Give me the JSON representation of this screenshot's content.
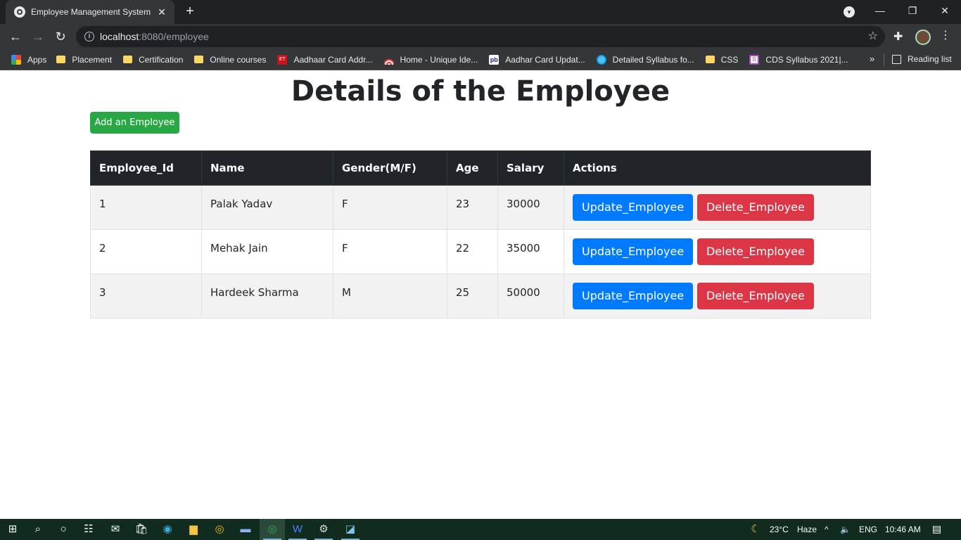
{
  "browser": {
    "tab_title": "Employee Management System",
    "tab_close": "✕",
    "new_tab": "+",
    "url_host": "localhost",
    "url_rest": ":8080/employee",
    "bookmarks": [
      {
        "label": "Apps",
        "icon": "apps-grid-icon"
      },
      {
        "label": "Placement",
        "icon": "folder-icon"
      },
      {
        "label": "Certification",
        "icon": "folder-icon"
      },
      {
        "label": "Online courses",
        "icon": "folder-icon"
      },
      {
        "label": "Aadhaar Card Addr...",
        "icon": "et-icon"
      },
      {
        "label": "Home - Unique Ide...",
        "icon": "uidai-icon"
      },
      {
        "label": "Aadhar Card Updat...",
        "icon": "pb-icon"
      },
      {
        "label": "Detailed Syllabus fo...",
        "icon": "globe-icon"
      },
      {
        "label": "CSS",
        "icon": "folder-icon"
      },
      {
        "label": "CDS Syllabus 2021|...",
        "icon": "cds-icon"
      }
    ],
    "bookmarks_more": "»",
    "reading_list": "Reading list"
  },
  "page": {
    "title": "Details of the Employee",
    "add_button": "Add an Employee",
    "table": {
      "headers": [
        "Employee_Id",
        "Name",
        "Gender(M/F)",
        "Age",
        "Salary",
        "Actions"
      ],
      "rows": [
        {
          "id": "1",
          "name": "Palak Yadav",
          "gender": "F",
          "age": "23",
          "salary": "30000"
        },
        {
          "id": "2",
          "name": "Mehak Jain",
          "gender": "F",
          "age": "22",
          "salary": "35000"
        },
        {
          "id": "3",
          "name": "Hardeek Sharma",
          "gender": "M",
          "age": "25",
          "salary": "50000"
        }
      ],
      "update_label": "Update_Employee",
      "delete_label": "Delete_Employee"
    }
  },
  "taskbar": {
    "temperature": "23°C",
    "weather": "Haze",
    "language": "ENG",
    "time": "10:46 AM"
  },
  "colors": {
    "update_button": "#007bff",
    "delete_button": "#dc3545",
    "add_button": "#28a745",
    "table_header": "#212529"
  }
}
